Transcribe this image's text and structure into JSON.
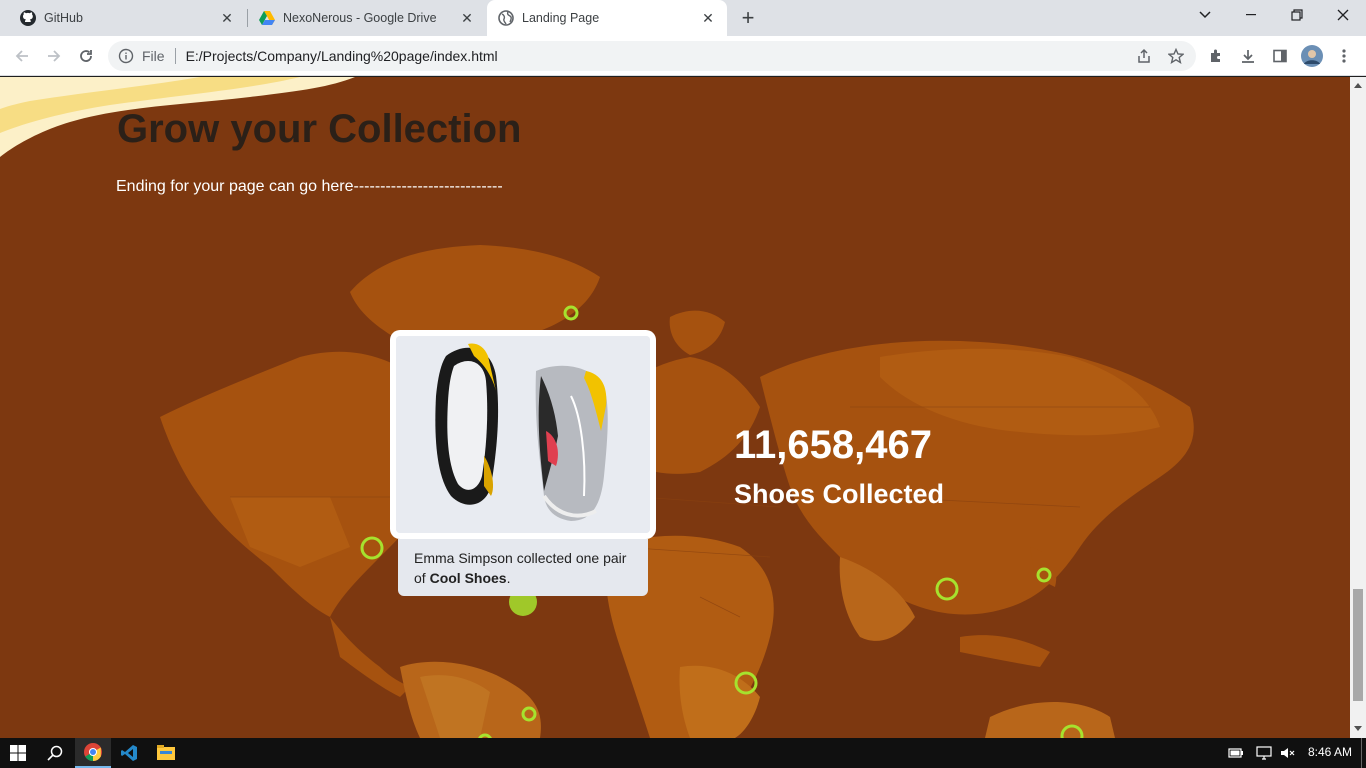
{
  "browser": {
    "tabs": [
      {
        "title": "GitHub",
        "icon": "github-icon"
      },
      {
        "title": "NexoNerous - Google Drive",
        "icon": "google-drive-icon"
      },
      {
        "title": "Landing Page",
        "icon": "globe-icon"
      }
    ],
    "new_tab_label": "+",
    "address": {
      "scheme_label": "File",
      "url": "E:/Projects/Company/Landing%20page/index.html"
    }
  },
  "page": {
    "heading": "Grow your Collection",
    "subtext": "Ending for your page can go here----------------------------",
    "stat": {
      "number": "11,658,467",
      "label": "Shoes Collected"
    },
    "card": {
      "caption_pre": "Emma Simpson collected one pair of ",
      "caption_bold": "Cool Shoes",
      "caption_post": "."
    }
  },
  "taskbar": {
    "time": "8:46 AM"
  },
  "colors": {
    "page_bg": "#7d3810",
    "map_land": "#a6520f",
    "map_highlight": "#c06e1a",
    "marker": "#a6e22e"
  }
}
